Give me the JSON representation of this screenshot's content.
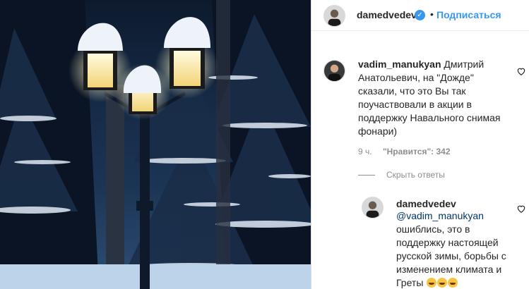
{
  "header": {
    "username": "damedvedev",
    "verified_mark": "✓",
    "separator": "•",
    "follow_label": "Подписаться"
  },
  "comment": {
    "username": "vadim_manukyan",
    "text": "Дмитрий Анатольевич, на \"Дожде\" сказали, что это Вы так поучаствовали в акции в поддержку Навального снимая фонари)",
    "time": "9 ч.",
    "likes": "\"Нравится\": 342"
  },
  "hide_replies_label": "Скрыть ответы",
  "reply": {
    "username": "damedvedev",
    "mention": "@vadim_manukyan",
    "text": "ошиблись, это в поддержку настоящей русской зимы, борьбы с изменением климата и Греты"
  },
  "icons": {
    "heart": "heart-icon",
    "verified": "verified-badge-icon",
    "emoji": "grinning-squint-emoji"
  },
  "colors": {
    "link_blue": "#3897f0",
    "mention_blue": "#00376b",
    "muted_gray": "#8e8e8e",
    "text_dark": "#262626"
  }
}
